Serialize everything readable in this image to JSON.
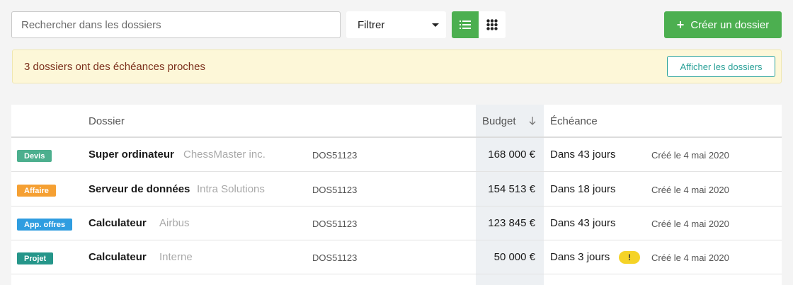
{
  "toolbar": {
    "search_placeholder": "Rechercher dans les dossiers",
    "filter_label": "Filtrer",
    "view_list_icon": "list-icon",
    "view_grid_icon": "grid-icon",
    "view_active": "list",
    "create_plus": "+",
    "create_label": "Créer un dossier",
    "accent": "#4caf50"
  },
  "alert": {
    "message": "3 dossiers ont des échéances proches",
    "action_label": "Afficher les dossiers",
    "background": "#fdf7d8",
    "text_color": "#7a2e1a",
    "action_color": "#2aa198"
  },
  "table": {
    "headers": {
      "dossier": "Dossier",
      "budget": "Budget",
      "echeance": "Échéance"
    },
    "sort_icon": "arrow-down-icon",
    "rows": [
      {
        "tag": "Devis",
        "tag_color": "#4caf8e",
        "name": "Super ordinateur",
        "client": "ChessMaster inc.",
        "code": "DOS51123",
        "budget": "168 000 €",
        "due": "Dans 43 jours",
        "warning": "",
        "created": "Créé le 4 mai 2020"
      },
      {
        "tag": "Affaire",
        "tag_color": "#f5a033",
        "name": "Serveur de données",
        "client": "Intra Solutions",
        "code": "DOS51123",
        "budget": "154 513 €",
        "due": "Dans 18 jours",
        "warning": "",
        "created": "Créé le 4 mai 2020"
      },
      {
        "tag": "App. offres",
        "tag_color": "#2f9de0",
        "name": "Calculateur",
        "client": "Airbus",
        "code": "DOS51123",
        "budget": "123 845 €",
        "due": "Dans 43 jours",
        "warning": "",
        "created": "Créé le 4 mai 2020"
      },
      {
        "tag": "Projet",
        "tag_color": "#25968a",
        "name": "Calculateur",
        "client": "Interne",
        "code": "DOS51123",
        "budget": "50 000 €",
        "due": "Dans 3 jours",
        "warning": "!",
        "created": "Créé le 4 mai 2020"
      }
    ]
  }
}
